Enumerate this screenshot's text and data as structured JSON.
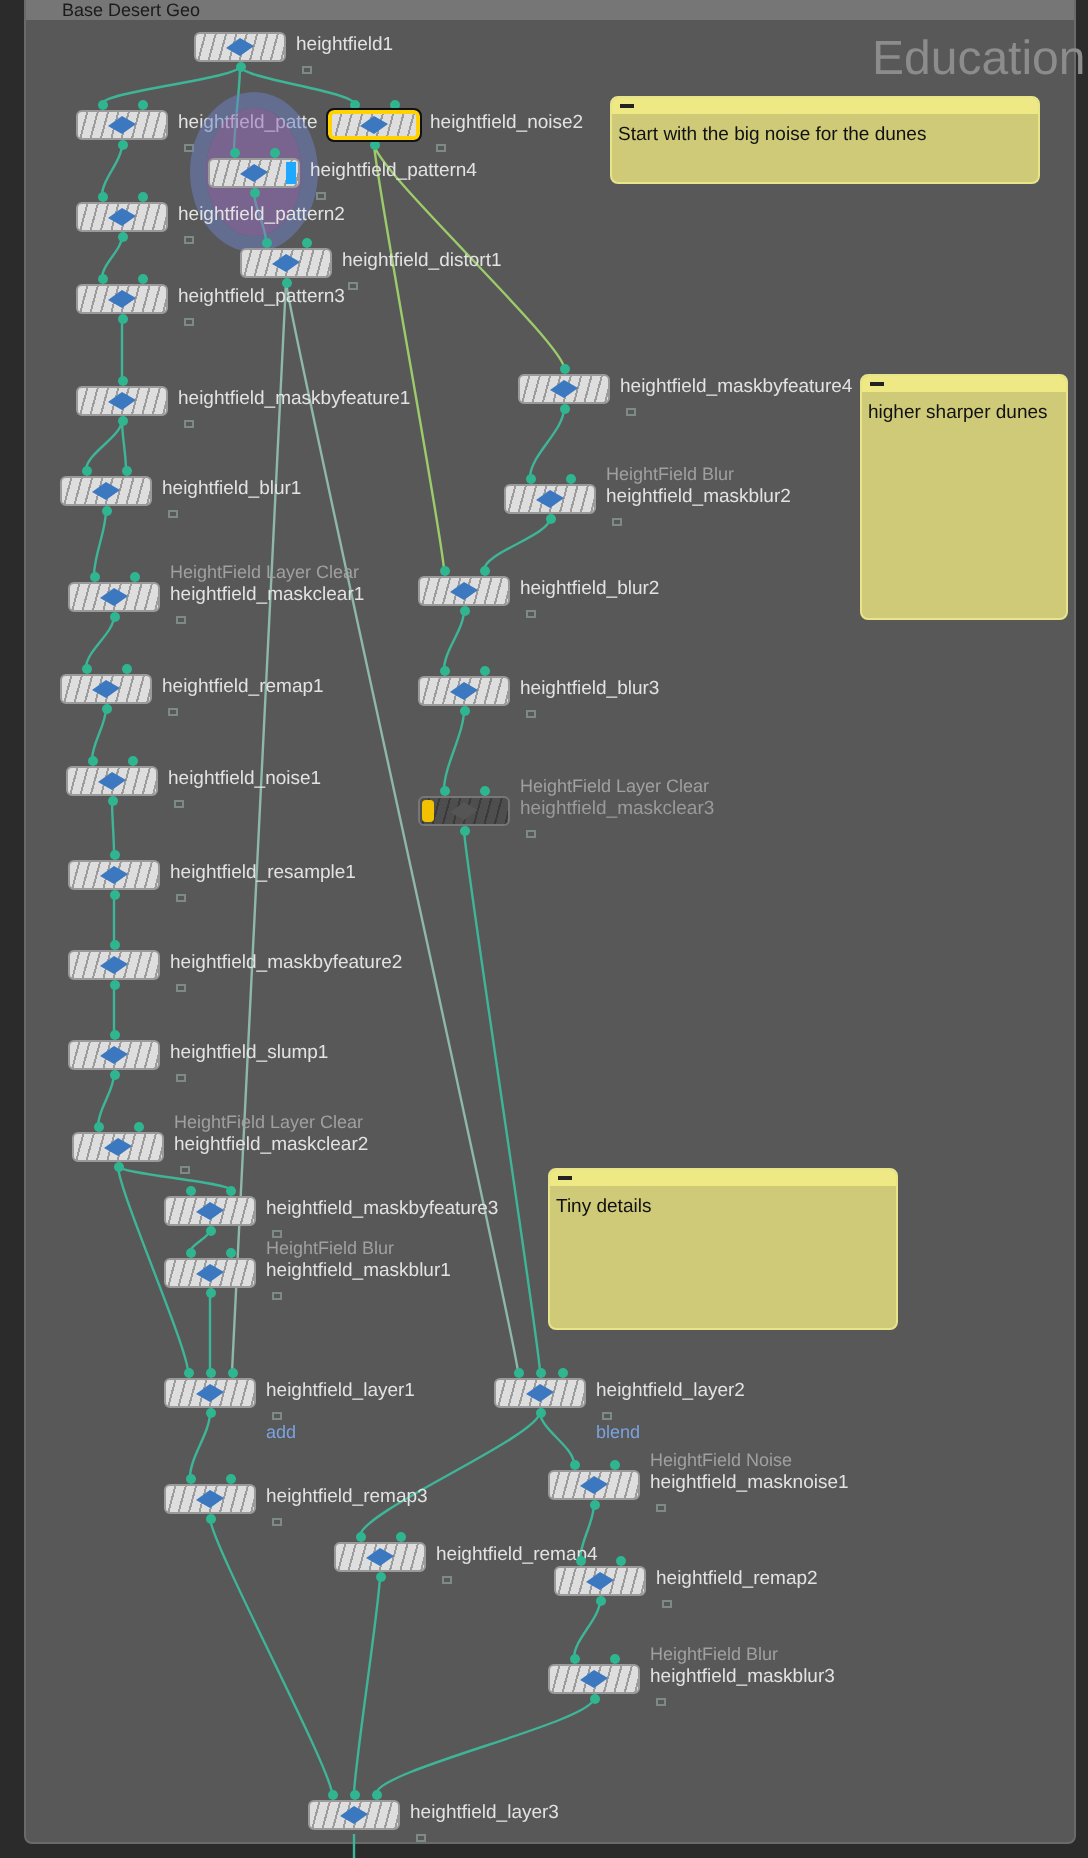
{
  "network_box": {
    "title": "Base Desert Geo"
  },
  "watermark": "Education",
  "nodes": [
    {
      "name": "heightfield1",
      "selected": false,
      "display": false,
      "bypassed": false
    },
    {
      "name": "heightfield_patte",
      "selected": false,
      "display": false,
      "bypassed": false
    },
    {
      "name": "heightfield_noise2",
      "selected": true,
      "display": false,
      "bypassed": false
    },
    {
      "name": "heightfield_pattern4",
      "selected": false,
      "display": true,
      "bypassed": false
    },
    {
      "name": "heightfield_pattern2",
      "selected": false,
      "display": false,
      "bypassed": false
    },
    {
      "name": "heightfield_distort1",
      "selected": false,
      "display": false,
      "bypassed": false
    },
    {
      "name": "heightfield_pattern3",
      "selected": false,
      "display": false,
      "bypassed": false
    },
    {
      "name": "heightfield_maskbyfeature1",
      "selected": false,
      "display": false,
      "bypassed": false
    },
    {
      "name": "heightfield_blur1",
      "selected": false,
      "display": false,
      "bypassed": false
    },
    {
      "name": "heightfield_maskclear1",
      "type_label": "HeightField Layer Clear",
      "selected": false,
      "display": false,
      "bypassed": false
    },
    {
      "name": "heightfield_remap1",
      "selected": false,
      "display": false,
      "bypassed": false
    },
    {
      "name": "heightfield_noise1",
      "selected": false,
      "display": false,
      "bypassed": false
    },
    {
      "name": "heightfield_resample1",
      "selected": false,
      "display": false,
      "bypassed": false
    },
    {
      "name": "heightfield_maskbyfeature2",
      "selected": false,
      "display": false,
      "bypassed": false
    },
    {
      "name": "heightfield_slump1",
      "selected": false,
      "display": false,
      "bypassed": false
    },
    {
      "name": "heightfield_maskclear2",
      "type_label": "HeightField Layer Clear",
      "selected": false,
      "display": false,
      "bypassed": false
    },
    {
      "name": "heightfield_maskbyfeature3",
      "selected": false,
      "display": false,
      "bypassed": false
    },
    {
      "name": "heightfield_maskblur1",
      "type_label": "HeightField Blur",
      "selected": false,
      "display": false,
      "bypassed": false
    },
    {
      "name": "heightfield_layer1",
      "flag": "add",
      "selected": false,
      "display": false,
      "bypassed": false
    },
    {
      "name": "heightfield_remap3",
      "selected": false,
      "display": false,
      "bypassed": false
    },
    {
      "name": "heightfield_layer3",
      "selected": false,
      "display": false,
      "bypassed": false
    },
    {
      "name": "heightfield_maskbyfeature4",
      "selected": false,
      "display": false,
      "bypassed": false
    },
    {
      "name": "heightfield_maskblur2",
      "type_label": "HeightField Blur",
      "selected": false,
      "display": false,
      "bypassed": false
    },
    {
      "name": "heightfield_blur2",
      "selected": false,
      "display": false,
      "bypassed": false
    },
    {
      "name": "heightfield_blur3",
      "selected": false,
      "display": false,
      "bypassed": false
    },
    {
      "name": "heightfield_maskclear3",
      "type_label": "HeightField Layer Clear",
      "selected": false,
      "display": false,
      "bypassed": true
    },
    {
      "name": "heightfield_layer2",
      "flag": "blend",
      "selected": false,
      "display": false,
      "bypassed": false
    },
    {
      "name": "heightfield_masknoise1",
      "type_label": "HeightField Noise",
      "selected": false,
      "display": false,
      "bypassed": false
    },
    {
      "name": "heightfield_remap4",
      "selected": false,
      "display": false,
      "bypassed": false
    },
    {
      "name": "heightfield_remap2",
      "selected": false,
      "display": false,
      "bypassed": false
    },
    {
      "name": "heightfield_maskblur3",
      "type_label": "HeightField Blur",
      "selected": false,
      "display": false,
      "bypassed": false
    }
  ],
  "sticky_notes": [
    {
      "text": "Start with the big noise for the dunes"
    },
    {
      "text": "higher sharper dunes"
    },
    {
      "text": "Tiny details"
    }
  ]
}
